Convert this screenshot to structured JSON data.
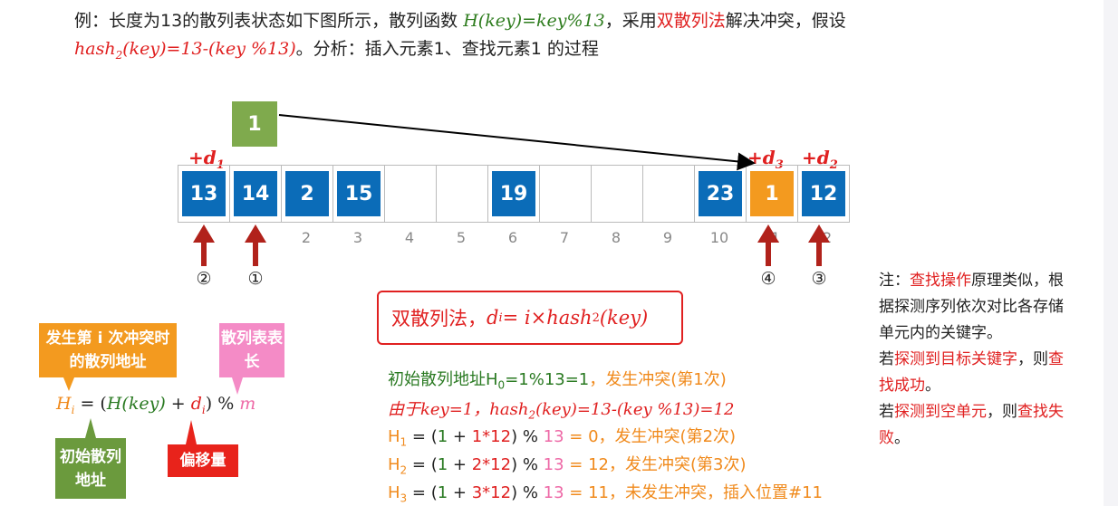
{
  "header": {
    "line1_prefix": "例：长度为13的散列表状态如下图所示，散列函数 ",
    "hash_func": "H(key)=key%13",
    "line1_mid": "，采用",
    "method": "双散列法",
    "line1_suffix": "解决冲突，假设",
    "hash2_a": "hash",
    "hash2_sub": "2",
    "hash2_b": "(key)=13-(key %13)",
    "line2_suffix": "。分析：插入元素1、查找元素1 的过程"
  },
  "table": {
    "cells": [
      {
        "value": "13",
        "color": "#0b6cb8"
      },
      {
        "value": "14",
        "color": "#0b6cb8"
      },
      {
        "value": "2",
        "color": "#0b6cb8"
      },
      {
        "value": "15",
        "color": "#0b6cb8"
      },
      {
        "value": "",
        "color": ""
      },
      {
        "value": "",
        "color": ""
      },
      {
        "value": "19",
        "color": "#0b6cb8"
      },
      {
        "value": "",
        "color": ""
      },
      {
        "value": "",
        "color": ""
      },
      {
        "value": "",
        "color": ""
      },
      {
        "value": "23",
        "color": "#0b6cb8"
      },
      {
        "value": "1",
        "color": "#f39a1f"
      },
      {
        "value": "12",
        "color": "#0b6cb8"
      }
    ],
    "indices": [
      "2",
      "3",
      "4",
      "5",
      "6",
      "7",
      "8",
      "9",
      "10",
      "11",
      "12"
    ],
    "new_key": "1"
  },
  "offsets": {
    "d1": {
      "plus": "+d",
      "sub": "1"
    },
    "d2": {
      "plus": "+d",
      "sub": "2"
    },
    "d3": {
      "plus": "+d",
      "sub": "3"
    }
  },
  "probe_order": [
    "②",
    "①",
    "④",
    "③"
  ],
  "note": {
    "p1_a": "注：",
    "p1_b": "查找操作",
    "p1_c": "原理类似，根据探测序列依次对比各存储单元内的关键字。",
    "p2_a": "若",
    "p2_b": "探测到目标关键字",
    "p2_c": "，则",
    "p2_d": "查找成功",
    "p2_e": "。",
    "p3_a": "若",
    "p3_b": "探测到空单元",
    "p3_c": "，则",
    "p3_d": "查找失败",
    "p3_e": "。"
  },
  "formula_box": {
    "prefix": "双散列法，",
    "d": "d",
    "i": "i",
    "eq": " = i×hash",
    "sub2": "2",
    "suffix": "(key)"
  },
  "calc": {
    "line1_a": "初始散列地址H",
    "line1_sub": "0",
    "line1_b": "=1%13=1",
    "line1_c": "，发生冲突(第1次)",
    "line2": "由于key=1，hash",
    "line2_sub": "2",
    "line2_b": "(key)=13-(key %13)=12",
    "h1": {
      "H": "H",
      "sub": "1",
      "eq": " = (",
      "one": "1",
      "plus": " + ",
      "term": "1*12",
      "mod": ") % ",
      "m": "13",
      "res": " = 0，发生冲突(第2次)"
    },
    "h2": {
      "H": "H",
      "sub": "2",
      "eq": " = (",
      "one": "1",
      "plus": " + ",
      "term": "2*12",
      "mod": ") % ",
      "m": "13",
      "res": " = 12，发生冲突(第3次)"
    },
    "h3": {
      "H": "H",
      "sub": "3",
      "eq": " = (",
      "one": "1",
      "plus": " + ",
      "term": "3*12",
      "mod": ") % ",
      "m": "13",
      "res": " = 11，未发生冲突，插入位置#11"
    }
  },
  "legend": {
    "tag_orange": "发生第 i 次冲突时的散列地址",
    "tag_pink": "散列表表长",
    "tag_green": "初始散列地址",
    "tag_red": "偏移量",
    "formula": {
      "H": "H",
      "i": "i",
      "eq": " = (",
      "Hkey": "H(key)",
      "plus": " + ",
      "d": "d",
      "di": "i",
      "close": ") % ",
      "m": "m"
    }
  },
  "colors": {
    "cell_blue": "#0b6cb8",
    "cell_orange": "#f39a1f",
    "new_key_green": "#7faa4d",
    "arrow_red": "#b1221b",
    "accent_red": "#e02020"
  }
}
